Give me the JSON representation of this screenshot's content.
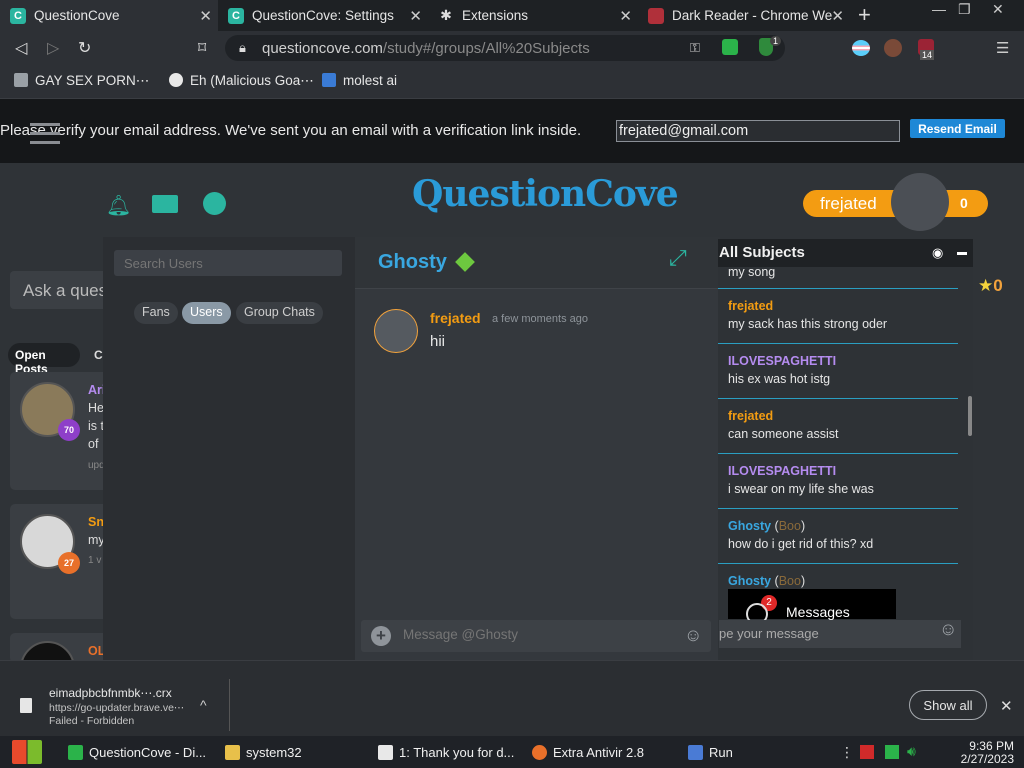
{
  "tabs": [
    {
      "title": "QuestionCove",
      "active": true
    },
    {
      "title": "QuestionCove: Settings",
      "active": false
    },
    {
      "title": "Extensions",
      "active": false
    },
    {
      "title": "Dark Reader - Chrome Web",
      "active": false
    }
  ],
  "address": {
    "host": "questioncove.com",
    "path": "/study#/groups/All%20Subjects"
  },
  "extensions": {
    "badge_count": "1",
    "puzzle_count": "14"
  },
  "bookmarks": [
    "GAY SEX PORN⋯",
    "Eh (Malicious Goa⋯",
    "molest ai"
  ],
  "verify": {
    "message": "Please verify your email address. We've sent you an email with a verification link inside.",
    "email": "frejated@gmail.com",
    "resend_label": "Resend Email"
  },
  "header": {
    "logo": "QuestionCove",
    "username": "frejated",
    "points": "0"
  },
  "sidebar": {
    "ask_placeholder": "Ask a ques",
    "open_posts": "Open Posts",
    "closed_tab_fragment": "Cl",
    "posts": [
      {
        "name_fragment": "Ari",
        "lines": [
          "He",
          "is t",
          "of"
        ],
        "meta": "upd",
        "level": "70",
        "level_color": "#8e3fc9"
      },
      {
        "name_fragment": "Sn",
        "lines": [
          "my"
        ],
        "meta": "1 v",
        "level": "27",
        "level_color": "#e8702a"
      },
      {
        "name_fragment": "OL",
        "lines": [],
        "meta": "",
        "level": "",
        "level_color": ""
      }
    ]
  },
  "chat": {
    "search_placeholder": "Search Users",
    "tabs": [
      "Fans",
      "Users",
      "Group Chats"
    ],
    "active_tab": "Users",
    "contact_name": "Ghosty",
    "messages": [
      {
        "author": "frejated",
        "time": "a few moments ago",
        "text": "hii"
      }
    ],
    "input_placeholder": "Message @Ghosty"
  },
  "subjects": {
    "title": "All Subjects",
    "partial_top": "my song",
    "messages": [
      {
        "author": "frejated",
        "role": "",
        "text": "my sack has this strong oder",
        "color": "#f39c12"
      },
      {
        "author": "ILOVESPAGHETTI",
        "role": "",
        "text": "his ex was hot istg",
        "color": "#b58cf0"
      },
      {
        "author": "frejated",
        "role": "",
        "text": "can someone assist",
        "color": "#f39c12"
      },
      {
        "author": "ILOVESPAGHETTI",
        "role": "",
        "text": "i swear on my life she was",
        "color": "#b58cf0"
      },
      {
        "author": "Ghosty",
        "role": "Boo",
        "text": "how do i get rid of this? xd",
        "color": "#39a7e0"
      },
      {
        "author": "Ghosty",
        "role": "Boo",
        "text": "",
        "color": "#39a7e0"
      }
    ],
    "embed_label": "Messages",
    "embed_badge": "2",
    "input_placeholder": "pe your message",
    "star_count": "0"
  },
  "download": {
    "file": "eimadpbcbfnmbk⋯.crx",
    "url": "https://go-updater.brave.ve⋯",
    "status": "Failed - Forbidden",
    "show_all": "Show all"
  },
  "taskbar": {
    "items": [
      "QuestionCove - Di...",
      "system32",
      "1: Thank you for d...",
      "Extra Antivir 2.8",
      "Run"
    ],
    "time": "9:36 PM",
    "date": "2/27/2023"
  },
  "colors": {
    "accent": "#39a7e0",
    "orange": "#f39c12",
    "teal": "#2bb5a0"
  }
}
